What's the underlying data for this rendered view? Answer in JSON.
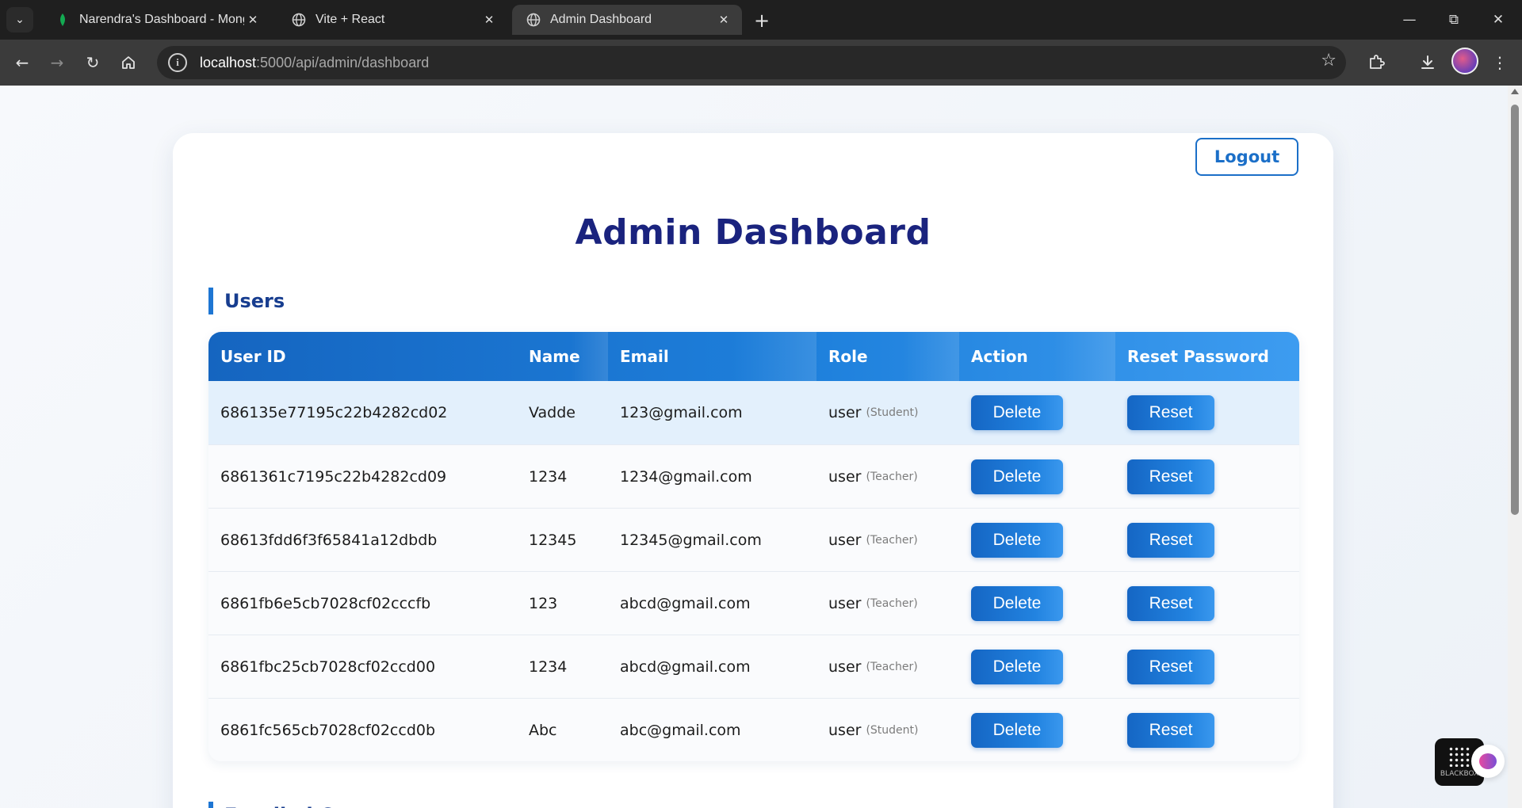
{
  "browser": {
    "tabs": [
      {
        "title": "Narendra's Dashboard - Mongo",
        "favicon": "mongodb-leaf-icon",
        "active": false
      },
      {
        "title": "Vite + React",
        "favicon": "globe-icon",
        "active": false
      },
      {
        "title": "Admin Dashboard",
        "favicon": "globe-icon",
        "active": true
      }
    ],
    "url_host": "localhost",
    "url_path": ":5000/api/admin/dashboard"
  },
  "page": {
    "logout_label": "Logout",
    "title": "Admin Dashboard",
    "users_heading": "Users",
    "courses_heading": "Enrolled Courses"
  },
  "users_table": {
    "headers": [
      "User ID",
      "Name",
      "Email",
      "Role",
      "Action",
      "Reset Password"
    ],
    "delete_label": "Delete",
    "reset_label": "Reset",
    "rows": [
      {
        "id": "686135e77195c22b4282cd02",
        "name": "Vadde",
        "email": "123@gmail.com",
        "role": "user",
        "type": "(Student)"
      },
      {
        "id": "6861361c7195c22b4282cd09",
        "name": "1234",
        "email": "1234@gmail.com",
        "role": "user",
        "type": "(Teacher)"
      },
      {
        "id": "68613fdd6f3f65841a12dbdb",
        "name": "12345",
        "email": "12345@gmail.com",
        "role": "user",
        "type": "(Teacher)"
      },
      {
        "id": "6861fb6e5cb7028cf02cccfb",
        "name": "123",
        "email": "abcd@gmail.com",
        "role": "user",
        "type": "(Teacher)"
      },
      {
        "id": "6861fbc25cb7028cf02ccd00",
        "name": "1234",
        "email": "abcd@gmail.com",
        "role": "user",
        "type": "(Teacher)"
      },
      {
        "id": "6861fc565cb7028cf02ccd0b",
        "name": "Abc",
        "email": "abc@gmail.com",
        "role": "user",
        "type": "(Student)"
      }
    ]
  },
  "widget_label": "BLACKBOX",
  "colors": {
    "primary": "#1e76d3",
    "title": "#1a237e",
    "heading": "#173d8f"
  }
}
